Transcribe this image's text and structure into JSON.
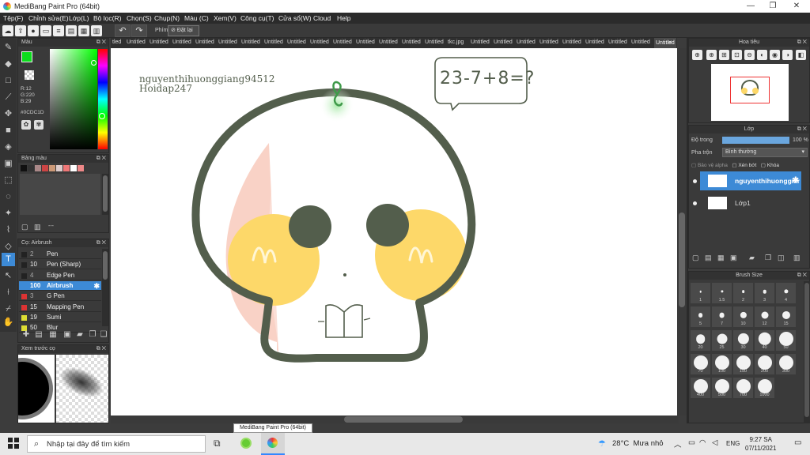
{
  "window": {
    "title": "MediBang Paint Pro (64bit)"
  },
  "menu": [
    "Tệp(F)",
    "Chỉnh sửa(E)",
    "Lớp(L)",
    "Bộ lọc(R)",
    "Chọn(S)",
    "Chụp(N)",
    "Màu (C)",
    "Xem(V)",
    "Công cụ(T)",
    "Cửa sổ(W)",
    "Cloud",
    "Help"
  ],
  "toolbar": {
    "label_snap": "Phím",
    "reset_label": "Đặt lại"
  },
  "color_panel": {
    "title": "Màu",
    "r": "R:12",
    "g": "G:220",
    "b": "B:29",
    "hex": "#0CDC1D",
    "main_color": "#0cdc1d"
  },
  "palette_panel": {
    "title": "Bảng màu",
    "footer": "---",
    "swatches": [
      "#111111",
      "#333333",
      "#aa8888",
      "#cc4444",
      "#cc9977",
      "#ddcccc",
      "#ee7777",
      "#ffffff",
      "#ee8888"
    ]
  },
  "brush_panel": {
    "title": "Cọ: Airbrush",
    "brushes": [
      {
        "size": "2",
        "name": "Pen",
        "color": "#222222",
        "dim": true
      },
      {
        "size": "10",
        "name": "Pen (Sharp)",
        "color": "#222222",
        "dim": false
      },
      {
        "size": "4",
        "name": "Edge Pen",
        "color": "#222222",
        "dim": true
      },
      {
        "size": "100",
        "name": "Airbrush",
        "color": "#3d8ad6",
        "dim": false
      },
      {
        "size": "3",
        "name": "G Pen",
        "color": "#dd3333",
        "dim": true
      },
      {
        "size": "15",
        "name": "Mapping Pen",
        "color": "#dd3333",
        "dim": false
      },
      {
        "size": "19",
        "name": "Sumi",
        "color": "#dddd33",
        "dim": false
      },
      {
        "size": "50",
        "name": "Blur",
        "color": "#dddd33",
        "dim": false
      }
    ],
    "selected": 3
  },
  "preview_panel": {
    "title": "Xem trước cọ"
  },
  "tabs": {
    "prefix": "tled",
    "items": [
      "Untitled",
      "Untitled",
      "Untitled",
      "Untitled",
      "Untitled",
      "Untitled",
      "Untitled",
      "Untitled",
      "Untitled",
      "Untitled",
      "Untitled",
      "Untitled",
      "Untitled",
      "Untitled",
      "tkc.jpg",
      "Untitled",
      "Untitled",
      "Untitled",
      "Untitled",
      "Untitled",
      "Untitled",
      "Untitled",
      "Untitled",
      "Untitled"
    ],
    "active": 23
  },
  "canvas": {
    "text_line1": "nguyenthihuonggiang94512",
    "text_line2": "Hoidap247",
    "bubble_text": "23-7+8=?"
  },
  "navigator": {
    "title": "Hoa tiêu"
  },
  "layer_panel": {
    "title": "Lớp",
    "opacity_label": "Độ trong",
    "opacity_value": "100 %",
    "opacity_fraction": 1.0,
    "blend_label": "Pha trộn",
    "blend_value": "Bình thường",
    "protect_alpha": "Bảo vệ alpha",
    "clip": "Xén bớt",
    "lock": "Khóa",
    "layers": [
      {
        "name": "nguyenthihuonggiang94512",
        "selected": true
      },
      {
        "name": "Lớp1",
        "selected": false
      }
    ]
  },
  "brush_size_panel": {
    "title": "Brush Size",
    "sizes": [
      "1",
      "1.5",
      "2",
      "3",
      "4",
      "5",
      "7",
      "10",
      "12",
      "15",
      "20",
      "25",
      "30",
      "40",
      "50",
      "70",
      "100",
      "150",
      "200",
      "300",
      "400",
      "500",
      "700",
      "1000"
    ]
  },
  "tooltip": "MediBang Paint Pro (64bit)",
  "taskbar": {
    "search_placeholder": "Nhập tại đây để tìm kiếm",
    "weather": "28°C  Mưa nhỏ",
    "lang": "ENG",
    "time": "9:27 SA",
    "date": "07/11/2021"
  }
}
